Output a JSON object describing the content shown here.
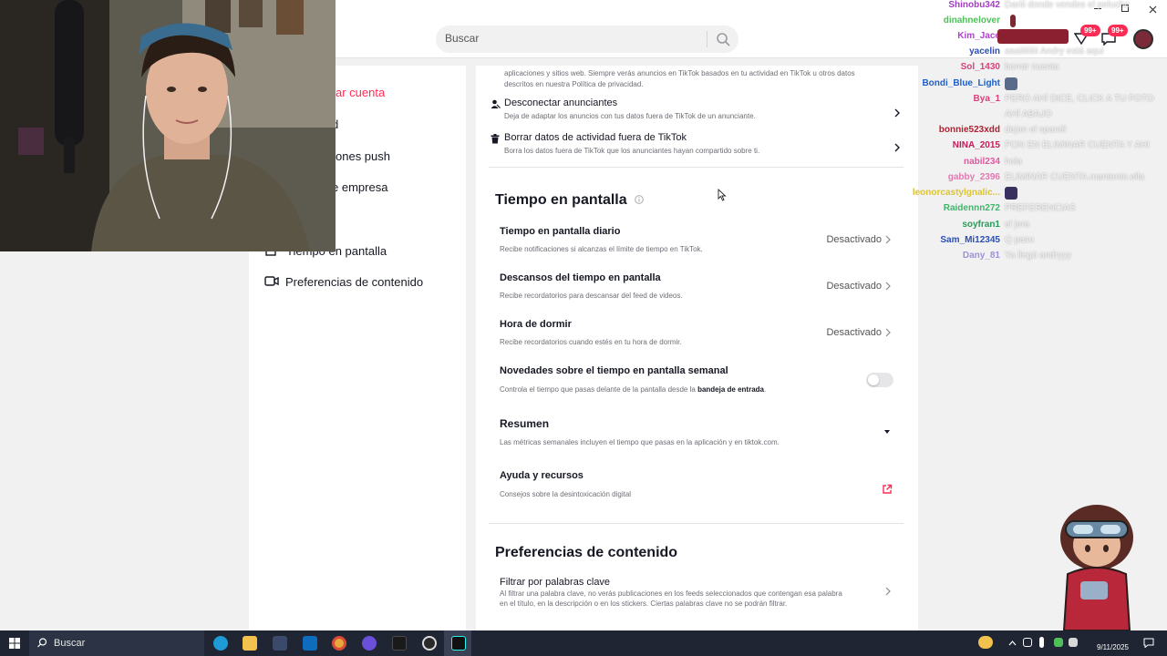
{
  "header": {
    "search_placeholder": "Buscar"
  },
  "left_nav": {
    "items": [
      {
        "label": "ar cuenta",
        "icon": "delete-account-icon",
        "active": true
      },
      {
        "label": "d",
        "icon": "privacy-icon",
        "active": false
      },
      {
        "label": "ones push",
        "icon": "bell-icon",
        "active": false
      },
      {
        "label": "e empresa",
        "icon": "business-icon",
        "active": false
      },
      {
        "label": "Tiempo en pantalla",
        "icon": "timer-icon",
        "active": false
      },
      {
        "label": "Preferencias de contenido",
        "icon": "video-icon",
        "active": false
      }
    ]
  },
  "ads": {
    "intro_line1": "aplicaciones y sitios web. Siempre verás anuncios en TikTok basados en tu actividad en TikTok u otros datos",
    "intro_line2": "descritos en nuestra Política de privacidad.",
    "disconnect_title": "Desconectar anunciantes",
    "disconnect_sub": "Deja de adaptar los anuncios con tus datos fuera de TikTok de un anunciante.",
    "delete_title": "Borrar datos de actividad fuera de TikTok",
    "delete_sub": "Borra los datos fuera de TikTok que los anunciantes hayan compartido sobre ti."
  },
  "screen_time": {
    "title": "Tiempo en pantalla",
    "daily_title": "Tiempo en pantalla diario",
    "daily_sub": "Recibe notificaciones si alcanzas el límite de tiempo en TikTok.",
    "daily_value": "Desactivado",
    "breaks_title": "Descansos del tiempo en pantalla",
    "breaks_sub": "Recibe recordatorios para descansar del feed de videos.",
    "breaks_value": "Desactivado",
    "sleep_title": "Hora de dormir",
    "sleep_sub": "Recibe recordatorios cuando estés en tu hora de dormir.",
    "sleep_value": "Desactivado",
    "weekly_title": "Novedades sobre el tiempo en pantalla semanal",
    "weekly_sub_prefix": "Controla el tiempo que pasas delante de la pantalla desde la",
    "weekly_sub_bold": "bandeja de entrada",
    "weekly_sub_suffix": ".",
    "weekly_enabled": false,
    "summary_title": "Resumen",
    "summary_sub": "Las métricas semanales incluyen el tiempo que pasas en la aplicación y en tiktok.com.",
    "help_title": "Ayuda y recursos",
    "help_sub": "Consejos sobre la desintoxicación digital"
  },
  "content_prefs": {
    "title": "Preferencias de contenido",
    "filter_title": "Filtrar por palabras clave",
    "filter_sub_line1": "Al filtrar una palabra clave, no verás publicaciones en los feeds seleccionados que contengan esa palabra",
    "filter_sub_line2": "en el título, en la descripción o en los stickers. Ciertas palabras clave no se podrán filtrar."
  },
  "badges": {
    "inbox_count": "99+",
    "messages_count": "99+"
  },
  "chat": [
    {
      "user": "Shinobu342",
      "msg": "Dariii donde vendes el peluche",
      "color": "#a43cc4"
    },
    {
      "user": "dinahnelover",
      "msg": "",
      "color": "#4fbf5a",
      "emote": true
    },
    {
      "user": "Kim_Jace",
      "msg": "",
      "color": "#b040d0"
    },
    {
      "user": "yacelin",
      "msg": "aaaiiiiiiiii Andry está aqui",
      "color": "#2a4fb5"
    },
    {
      "user": "Sol_1430",
      "msg": "borrar cuenta",
      "color": "#d8407a"
    },
    {
      "user": "Bondi_Blue_Light",
      "msg": "",
      "color": "#1f5fc8",
      "emote": true
    },
    {
      "user": "Bya_1",
      "msg": "PERO AHÍ DICE, CLICK A TU FOTO",
      "color": "#d8407a"
    },
    {
      "user": "",
      "msg": "AHÍ ABAJO",
      "color": "#d8407a"
    },
    {
      "user": "bonnie523xdd",
      "msg": "dejan el spanél",
      "color": "#b02030"
    },
    {
      "user": "NINA_2015",
      "msg": "PON EN ELIMINAR CUENTA Y AHI",
      "color": "#c0205a"
    },
    {
      "user": "nabil234",
      "msg": "hola",
      "color": "#e05aa0"
    },
    {
      "user": "gabby_2396",
      "msg": "ELIMINAR CUENTA.mantente.ella",
      "color": "#e07ab0"
    },
    {
      "user": "leonorcastylgnalic...",
      "msg": "",
      "color": "#d9c43a",
      "emote": true
    },
    {
      "user": "Raidennn272",
      "msg": "PREFERENCIAS",
      "color": "#3fb56a"
    },
    {
      "user": "soyfran1",
      "msg": "el jera",
      "color": "#2a9a5a"
    },
    {
      "user": "Sam_Mi12345",
      "msg": "Q paso",
      "color": "#2a4fb5"
    },
    {
      "user": "Dany_81",
      "msg": "Ya llegó andryyy",
      "color": "#a090d8"
    }
  ],
  "taskbar": {
    "search_label": "Buscar",
    "time": "",
    "date": "9/11/2025"
  }
}
